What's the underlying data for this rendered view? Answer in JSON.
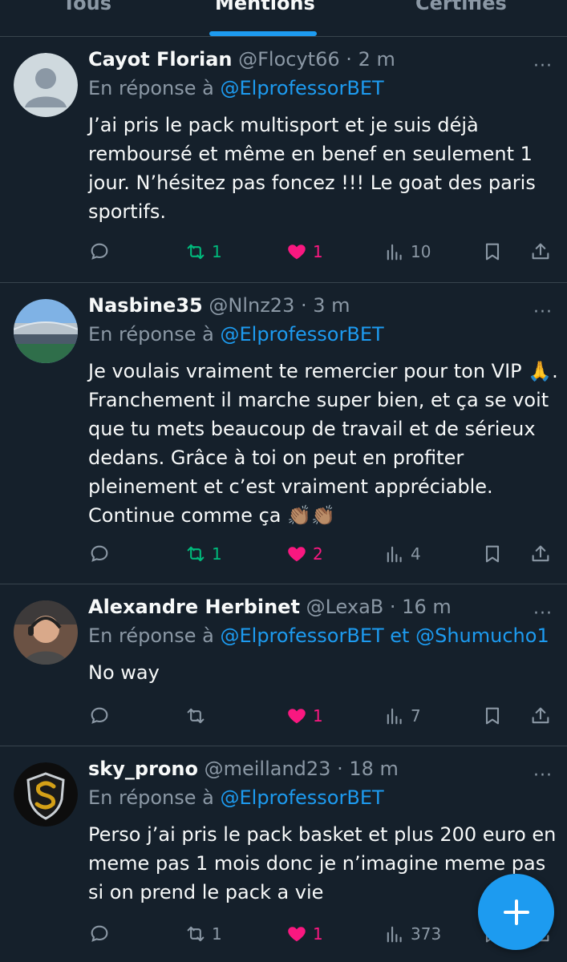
{
  "tabs": [
    {
      "label": "Tous",
      "active": false
    },
    {
      "label": "Mentions",
      "active": true
    },
    {
      "label": "Certifiés",
      "active": false
    }
  ],
  "colors": {
    "background": "#15202b",
    "accent": "#1d9bf0",
    "retweet": "#00ba7c",
    "like": "#f91880",
    "muted": "#8b98a5"
  },
  "tweets": [
    {
      "name": "Cayot Florian",
      "handle": "@Flocyt66",
      "time": "2 m",
      "reply_prefix": "En réponse à",
      "reply_to": "@ElprofessorBET",
      "text": "J’ai pris le pack multisport et je suis déjà remboursé et même en benef en seulement 1 jour. N’hésitez pas foncez !!! Le goat des paris sportifs.",
      "replies": "",
      "retweets": "1",
      "likes": "1",
      "views": "10",
      "avatar": "default-avatar"
    },
    {
      "name": "Nasbine35",
      "handle": "@Nlnz23",
      "time": "3 m",
      "reply_prefix": "En réponse à",
      "reply_to": "@ElprofessorBET",
      "text": "Je voulais vraiment te remercier pour ton VIP 🙏. Franchement il marche super bien, et ça se voit que tu mets beaucoup de travail et de sérieux dedans. Grâce à toi on peut en profiter pleinement et c’est vraiment appréciable. Continue comme ça 👏🏽👏🏽",
      "replies": "",
      "retweets": "1",
      "likes": "2",
      "views": "4",
      "avatar": "stadium-photo"
    },
    {
      "name": "Alexandre Herbinet",
      "handle": "@LexaB",
      "time": "16 m",
      "reply_prefix": "En réponse à",
      "reply_to": "@ElprofessorBET",
      "reply_and": "et",
      "reply_to_2": "@Shumucho1",
      "text": "No way",
      "replies": "",
      "retweets": "",
      "likes": "1",
      "views": "7",
      "avatar": "man-headset-photo"
    },
    {
      "name": "sky_prono",
      "handle": "@meilland23",
      "time": "18 m",
      "reply_prefix": "En réponse à",
      "reply_to": "@ElprofessorBET",
      "text": "Perso j’ai pris le pack basket et plus 200 euro en meme pas 1 mois donc je n’imagine meme pas si on prend le pack a vie",
      "replies": "",
      "retweets": "1",
      "likes": "1",
      "views": "373",
      "avatar": "shield-s-logo"
    }
  ],
  "dot": "·",
  "more_glyph": "···",
  "fab_glyph": "+"
}
